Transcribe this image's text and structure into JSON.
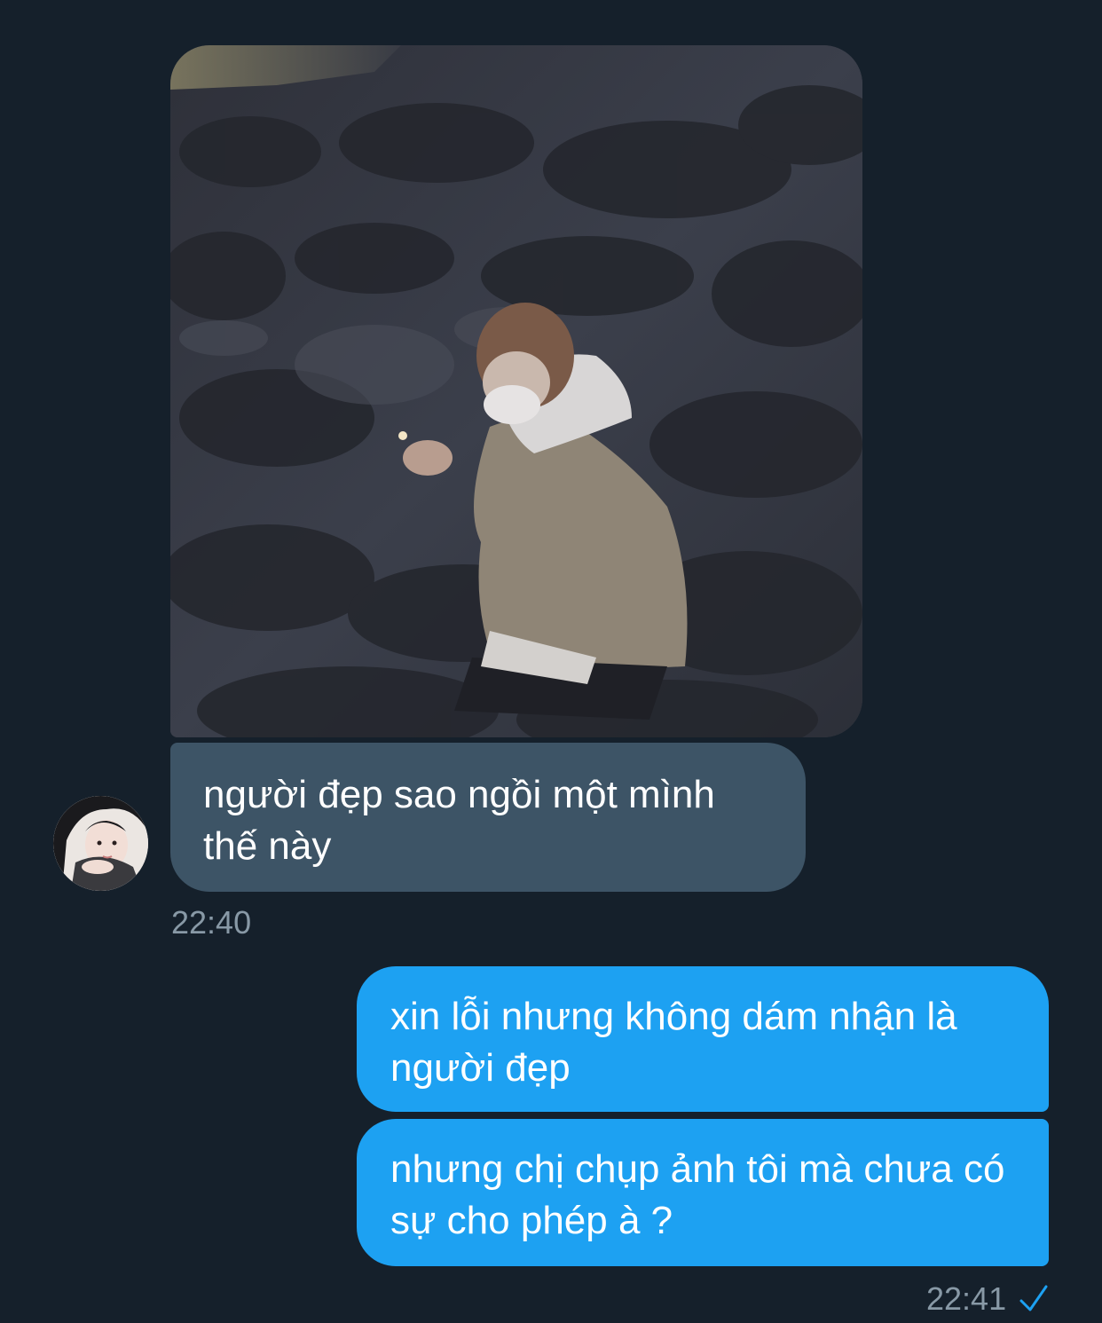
{
  "conversation": {
    "incoming": {
      "photo_name": "photo-message",
      "message": "người đẹp sao ngồi một mình thế này",
      "time": "22:40"
    },
    "outgoing": {
      "messages": [
        "xin lỗi nhưng không dám nhận là người đẹp",
        "nhưng chị chụp ảnh tôi mà chưa có sự cho phép à ?"
      ],
      "time": "22:41",
      "status_icon": "check-icon"
    }
  },
  "colors": {
    "background": "#15202b",
    "incoming_bubble": "#3d5466",
    "outgoing_bubble": "#1da1f2",
    "timestamp": "#8899a6",
    "check": "#1da1f2"
  }
}
